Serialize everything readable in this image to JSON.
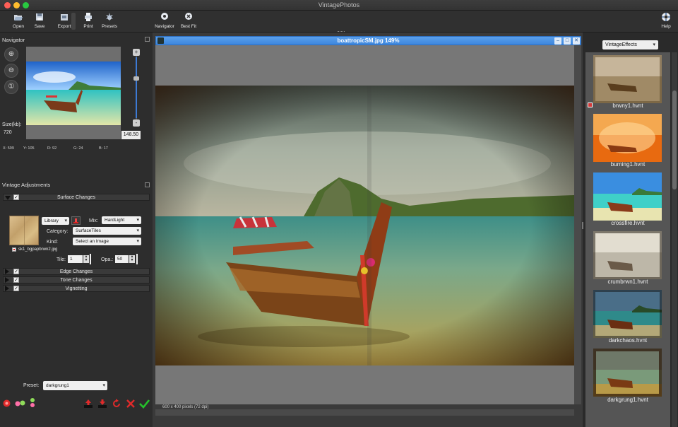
{
  "window": {
    "title": "VintagePhotos"
  },
  "toolbar": {
    "open": "Open",
    "save": "Save",
    "export": "Export",
    "print": "Print",
    "presets": "Presets",
    "navigator": "Navigator",
    "best_fit": "Best Fit",
    "help": "Help"
  },
  "navigator": {
    "title": "Navigator",
    "size_label": "Size(kb):",
    "size_value": "720",
    "zoom_value": "148.50",
    "pixel": {
      "x": "X: 599",
      "y": "Y: 105",
      "r": "R: 92",
      "g": "G: 24",
      "b": "B: 17"
    }
  },
  "adjustments": {
    "title": "Vintage Adjustments",
    "sections": [
      "Surface Changes",
      "Edge Changes",
      "Tone Changes",
      "Vignetting"
    ],
    "surface": {
      "source": "Library",
      "mix_label": "Mix:",
      "mix_value": "HardLight",
      "category_label": "Category:",
      "category_value": "SurfaceTiles",
      "kind_label": "Kind:",
      "kind_value": "Select an Image",
      "file_name": "sk1_bgpapbrwn2.jpg",
      "tile_label": "Tile:",
      "tile_value": "1",
      "opacity_label": "Opa.:",
      "opacity_value": "50"
    }
  },
  "preset": {
    "label": "Preset:",
    "value": "darkgrung1"
  },
  "document": {
    "title": "boattropicSM.jpg 149%",
    "dimensions": "600 x 400 pixels (72 dpi)"
  },
  "effects": {
    "dropdown": "VintageEffects",
    "items": [
      "brwny1.hvnt",
      "burning1.hvnt",
      "crossfire.hvnt",
      "crumbrwn1.hvnt",
      "darkchaos.hvnt",
      "darkgrung1.hvnt"
    ]
  },
  "colors": {
    "accent": "#3d86dd",
    "panel": "#2d2d2d",
    "canvas": "#777777"
  }
}
